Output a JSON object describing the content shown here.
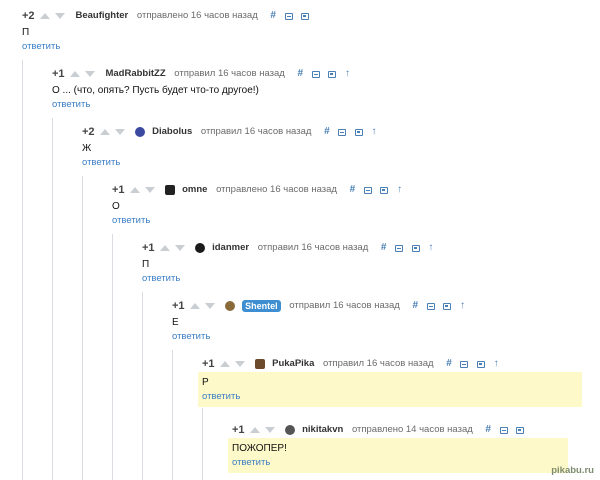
{
  "comments": [
    {
      "rating": "+2",
      "user": "Beaufighter",
      "action": "отправлено 16 часов назад",
      "text": "П",
      "reply": "ответить"
    },
    {
      "rating": "+1",
      "user": "MadRabbitZZ",
      "action": "отправил 16 часов назад",
      "text": "О ... (что, опять? Пусть будет что-то другое!)",
      "reply": "ответить"
    },
    {
      "rating": "+2",
      "user": "Diabolus",
      "action": "отправил 16 часов назад",
      "text": "Ж",
      "reply": "ответить"
    },
    {
      "rating": "+1",
      "user": "omne",
      "action": "отправлено 16 часов назад",
      "text": "О",
      "reply": "ответить"
    },
    {
      "rating": "+1",
      "user": "idanmer",
      "action": "отправил 16 часов назад",
      "text": "П",
      "reply": "ответить"
    },
    {
      "rating": "+1",
      "user": "Shentel",
      "action": "отправил 16 часов назад",
      "text": "Е",
      "reply": "ответить"
    },
    {
      "rating": "+1",
      "user": "PukaPika",
      "action": "отправил 16 часов назад",
      "text": "Р",
      "reply": "ответить"
    },
    {
      "rating": "+1",
      "user": "nikitakvn",
      "action": "отправлено 14 часов назад",
      "text": "ПОЖОПЕР!",
      "reply": "ответить"
    }
  ],
  "icons": {
    "hash": "#",
    "arrow": "↑"
  },
  "watermark": "pikabu.ru",
  "colors": {
    "highlight": "#fdf9c9",
    "link": "#3b7ec6",
    "badge": "#3d8fd1"
  }
}
